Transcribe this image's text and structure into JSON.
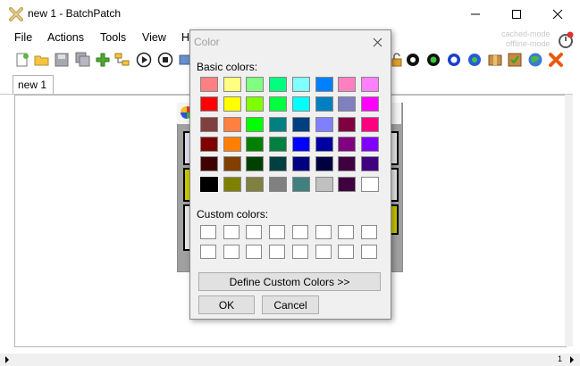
{
  "window": {
    "title": "new 1 - BatchPatch",
    "minimize_icon": "minimize-icon",
    "maximize_icon": "maximize-icon",
    "close_icon": "close-icon"
  },
  "menu": [
    "File",
    "Actions",
    "Tools",
    "View",
    "H"
  ],
  "mode": {
    "cached": "cached-mode",
    "offline": "offline-mode"
  },
  "tab": {
    "label": "new 1"
  },
  "status": {
    "page": "1"
  },
  "color_dialog": {
    "title": "Color",
    "basic_label": "Basic colors:",
    "custom_label": "Custom colors:",
    "define_button": "Define Custom Colors >>",
    "ok_button": "OK",
    "cancel_button": "Cancel",
    "selected_color": "#000000",
    "basic_colors": [
      [
        "#ff8080",
        "#ffff80",
        "#80ff80",
        "#00ff80",
        "#80ffff",
        "#0080ff",
        "#ff80c0",
        "#ff80ff"
      ],
      [
        "#ff0000",
        "#ffff00",
        "#80ff00",
        "#00ff40",
        "#00ffff",
        "#0080c0",
        "#8080c0",
        "#ff00ff"
      ],
      [
        "#804040",
        "#ff8040",
        "#00ff00",
        "#008080",
        "#004080",
        "#8080ff",
        "#800040",
        "#ff0080"
      ],
      [
        "#800000",
        "#ff8000",
        "#008000",
        "#008040",
        "#0000ff",
        "#0000a0",
        "#800080",
        "#8000ff"
      ],
      [
        "#400000",
        "#804000",
        "#004000",
        "#004040",
        "#000080",
        "#000040",
        "#400040",
        "#400080"
      ],
      [
        "#000000",
        "#808000",
        "#808040",
        "#808080",
        "#408080",
        "#c0c0c0",
        "#400040",
        "#ffffff"
      ]
    ]
  }
}
